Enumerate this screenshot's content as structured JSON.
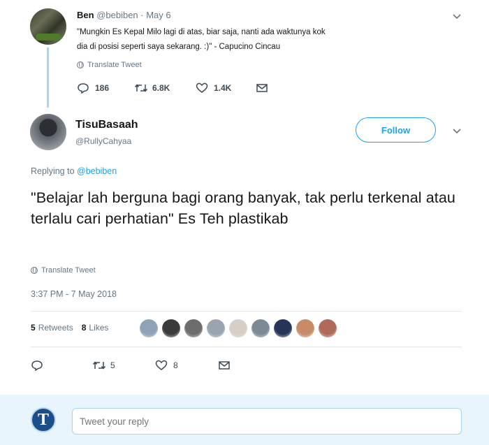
{
  "parent_tweet": {
    "name": "Ben",
    "handle_date": "@bebiben · May 6",
    "text": "\"Mungkin Es Kepal Milo lagi di atas, biar saja, nanti ada waktunya kok dia di posisi seperti saya sekarang. :)\" - Capucino Cincau",
    "translate_label": "Translate Tweet",
    "reply_count": "186",
    "retweet_count": "6.8K",
    "like_count": "1.4K"
  },
  "main_tweet": {
    "name": "TisuBasaah",
    "handle": "@RullyCahyaa",
    "follow_label": "Follow",
    "replying_prefix": "Replying to",
    "replying_to": "@bebiben",
    "text": "\"Belajar lah berguna bagi orang banyak, tak perlu terkenal atau terlalu cari perhatian\" Es Teh plastikab",
    "translate_label": "Translate Tweet",
    "timestamp": "3:37 PM - 7 May 2018",
    "retweets_count": "5",
    "retweets_label": "Retweets",
    "likes_count": "8",
    "likes_label": "Likes",
    "liker_avatar_colors": [
      "#8fa3b8",
      "#3b3b3b",
      "#6d6d6d",
      "#9aa4ae",
      "#d7cfc6",
      "#7d8a96",
      "#26345c",
      "#c98a6a",
      "#b06a5a"
    ],
    "retweet_action_count": "5",
    "like_action_count": "8"
  },
  "reply_bar": {
    "avatar_letter": "T",
    "placeholder": "Tweet your reply"
  },
  "colors": {
    "accent": "#1da1f2",
    "thread_line": "#a8d6ee",
    "muted_text": "#657786",
    "reply_bar_bg": "#e8f5fd"
  }
}
